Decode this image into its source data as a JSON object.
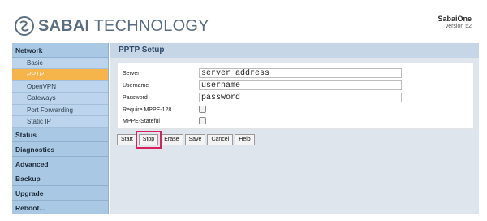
{
  "header": {
    "logo_bold": "SABAI",
    "logo_rest": "TECHNOLOGY",
    "product": "SabaiOne",
    "version": "version 52"
  },
  "sidebar": {
    "network": "Network",
    "network_items": [
      "Basic",
      "PPTP",
      "OpenVPN",
      "Gateways",
      "Port Forwarding",
      "Static IP"
    ],
    "active_item": "PPTP",
    "sections": [
      "Status",
      "Diagnostics",
      "Advanced",
      "Backup",
      "Upgrade",
      "Reboot..."
    ]
  },
  "main": {
    "title": "PPTP Setup",
    "fields": {
      "server": {
        "label": "Server",
        "value": "server address"
      },
      "username": {
        "label": "Username",
        "value": "username"
      },
      "password": {
        "label": "Password",
        "value": "password"
      },
      "mppe128": {
        "label": "Require MPPE-128"
      },
      "mppe_stateful": {
        "label": "MPPE-Stateful"
      }
    },
    "buttons": [
      "Start",
      "Stop",
      "Erase",
      "Save",
      "Cancel",
      "Help"
    ],
    "highlighted_button": "Stop"
  },
  "colors": {
    "sidebar": "#a9c8e4",
    "active": "#f5b54b",
    "highlight": "#d8215c",
    "title": "#2f4a68"
  }
}
